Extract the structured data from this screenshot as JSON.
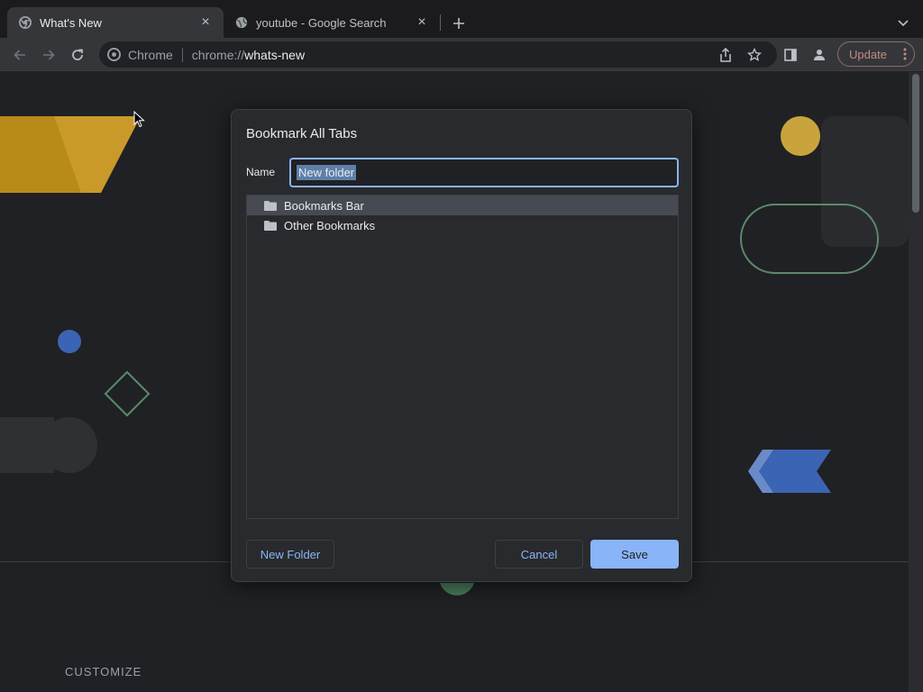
{
  "tabs": [
    {
      "title": "What's New",
      "favicon": "chrome-icon",
      "active": true
    },
    {
      "title": "youtube - Google Search",
      "favicon": "globe-icon",
      "active": false
    }
  ],
  "toolbar": {
    "site_name": "Chrome",
    "url_scheme": "chrome://",
    "url_host": "whats-new",
    "update_label": "Update"
  },
  "page": {
    "customize_label": "CUSTOMIZE"
  },
  "dialog": {
    "title": "Bookmark All Tabs",
    "name_label": "Name",
    "name_value": "New folder",
    "folders": [
      {
        "label": "Bookmarks Bar",
        "selected": true
      },
      {
        "label": "Other Bookmarks",
        "selected": false
      }
    ],
    "new_folder_label": "New Folder",
    "cancel_label": "Cancel",
    "save_label": "Save"
  },
  "colors": {
    "accent": "#8ab4f8",
    "background": "#202124",
    "dialog_bg": "#292a2d",
    "update_accent": "#c58b82"
  }
}
